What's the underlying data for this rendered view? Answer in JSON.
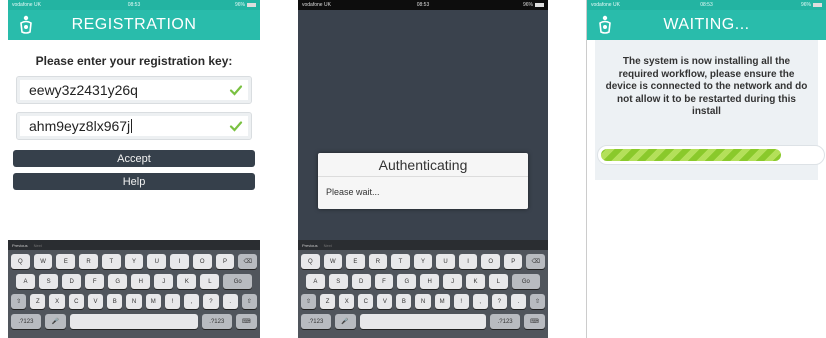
{
  "colors": {
    "header_teal": "#29bcab",
    "button_dark": "#36404b",
    "check_green": "#7ac142",
    "progress_green": "#8ac92b",
    "backdrop": "#3a424d"
  },
  "status": {
    "carrier": "vodafone UK",
    "time": "08:53",
    "battery": "96%"
  },
  "screen1": {
    "header_title": "REGISTRATION",
    "prompt": "Please enter your registration key:",
    "key1_value": "eewy3z2431y26q",
    "key2_value": "ahm9eyz8lx967j",
    "accept_label": "Accept",
    "help_label": "Help"
  },
  "screen2": {
    "dialog_title": "Authenticating",
    "dialog_message": "Please wait..."
  },
  "screen3": {
    "header_title": "WAITING...",
    "install_message": "The system is now installing all the required workflow, please ensure the device is connected to the network and do not allow it to be restarted during this install",
    "progress_fraction": 0.82
  },
  "keyboard": {
    "prev_label": "Previous",
    "next_label": "Next",
    "row1": [
      "Q",
      "W",
      "E",
      "R",
      "T",
      "Y",
      "U",
      "I",
      "O",
      "P",
      "⌫"
    ],
    "row2": [
      "A",
      "S",
      "D",
      "F",
      "G",
      "H",
      "J",
      "K",
      "L",
      "Go"
    ],
    "row3": [
      "⇧",
      "Z",
      "X",
      "C",
      "V",
      "B",
      "N",
      "M",
      "!",
      ",",
      "?",
      ".",
      "⇧"
    ],
    "key_numbers": ".?123",
    "key_mic": "🎤",
    "key_hide": "⌨"
  },
  "icons": {
    "logo": "person-logo-icon",
    "check": "check-icon",
    "mic": "microphone-icon",
    "hide_keyboard": "keyboard-hide-icon"
  }
}
